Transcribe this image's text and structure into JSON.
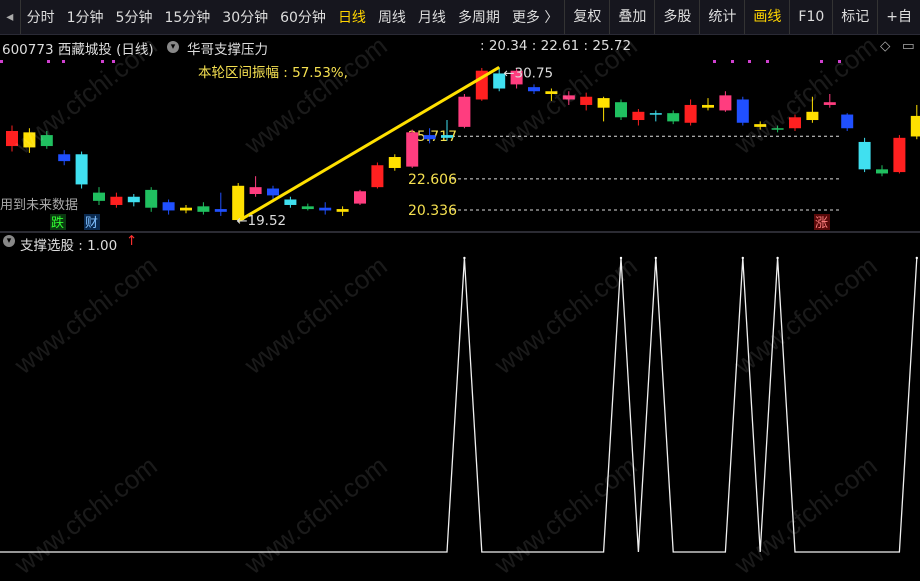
{
  "toolbar": {
    "periods": [
      "分时",
      "1分钟",
      "5分钟",
      "15分钟",
      "30分钟",
      "60分钟",
      "日线",
      "周线",
      "月线",
      "多周期",
      "更多 〉"
    ],
    "active_period": "日线",
    "tools": [
      "复权",
      "叠加",
      "多股",
      "统计",
      "画线",
      "F10",
      "标记",
      "+自"
    ],
    "highlight_tool": "画线"
  },
  "info": {
    "stock": "600773 西藏城投 (日线)",
    "indicator_name": "华哥支撑压力",
    "indicator_values": ": 20.34 : 22.61 : 25.72"
  },
  "sub_header": {
    "label": "支撑选股 : 1.00",
    "arrow": "↑"
  },
  "watermark": "www.cfchi.com",
  "chart_data": [
    {
      "type": "candlestick",
      "name": "华哥支撑压力",
      "ylim": [
        18.8,
        31.5
      ],
      "candles": [
        {
          "o": 25.0,
          "c": 26.1,
          "h": 26.5,
          "l": 24.6
        },
        {
          "o": 24.9,
          "c": 26.0,
          "h": 26.3,
          "l": 24.5
        },
        {
          "o": 25.8,
          "c": 25.0,
          "h": 26.1,
          "l": 24.8
        },
        {
          "o": 24.4,
          "c": 23.9,
          "h": 24.7,
          "l": 23.6
        },
        {
          "o": 24.4,
          "c": 22.2,
          "h": 24.6,
          "l": 21.9
        },
        {
          "o": 21.6,
          "c": 21.0,
          "h": 22.0,
          "l": 20.7
        },
        {
          "o": 20.7,
          "c": 21.3,
          "h": 21.6,
          "l": 20.5
        },
        {
          "o": 21.3,
          "c": 20.9,
          "h": 21.5,
          "l": 20.6
        },
        {
          "o": 21.8,
          "c": 20.5,
          "h": 22.0,
          "l": 20.2
        },
        {
          "o": 20.9,
          "c": 20.3,
          "h": 21.1,
          "l": 20.0
        },
        {
          "o": 20.3,
          "c": 20.5,
          "h": 20.7,
          "l": 20.1
        },
        {
          "o": 20.6,
          "c": 20.2,
          "h": 20.9,
          "l": 20.0
        },
        {
          "o": 20.4,
          "c": 20.2,
          "h": 21.6,
          "l": 19.9
        },
        {
          "o": 19.6,
          "c": 22.1,
          "h": 22.3,
          "l": 19.5
        },
        {
          "o": 21.5,
          "c": 22.0,
          "h": 22.8,
          "l": 21.3
        },
        {
          "o": 21.9,
          "c": 21.4,
          "h": 22.1,
          "l": 21.1
        },
        {
          "o": 21.1,
          "c": 20.7,
          "h": 21.3,
          "l": 20.5
        },
        {
          "o": 20.6,
          "c": 20.4,
          "h": 20.8,
          "l": 20.3
        },
        {
          "o": 20.5,
          "c": 20.3,
          "h": 20.9,
          "l": 20.0
        },
        {
          "o": 20.2,
          "c": 20.4,
          "h": 20.6,
          "l": 19.9
        },
        {
          "o": 20.8,
          "c": 21.7,
          "h": 21.8,
          "l": 20.7
        },
        {
          "o": 22.0,
          "c": 23.6,
          "h": 23.8,
          "l": 21.9
        },
        {
          "o": 23.4,
          "c": 24.2,
          "h": 24.4,
          "l": 23.2
        },
        {
          "o": 23.5,
          "c": 26.0,
          "h": 26.2,
          "l": 23.4
        },
        {
          "o": 25.8,
          "c": 25.5,
          "h": 26.3,
          "l": 25.2
        },
        {
          "o": 25.8,
          "c": 25.6,
          "h": 26.9,
          "l": 25.4
        },
        {
          "o": 26.4,
          "c": 28.6,
          "h": 28.8,
          "l": 26.3
        },
        {
          "o": 28.4,
          "c": 30.5,
          "h": 30.7,
          "l": 28.3
        },
        {
          "o": 30.3,
          "c": 29.2,
          "h": 30.75,
          "l": 29.0
        },
        {
          "o": 29.5,
          "c": 30.5,
          "h": 30.7,
          "l": 29.2
        },
        {
          "o": 29.3,
          "c": 29.0,
          "h": 29.5,
          "l": 28.8
        },
        {
          "o": 28.8,
          "c": 29.0,
          "h": 29.2,
          "l": 28.3
        },
        {
          "o": 28.4,
          "c": 28.7,
          "h": 29.0,
          "l": 28.0
        },
        {
          "o": 28.0,
          "c": 28.6,
          "h": 28.9,
          "l": 27.6
        },
        {
          "o": 27.8,
          "c": 28.5,
          "h": 28.6,
          "l": 26.8
        },
        {
          "o": 28.2,
          "c": 27.1,
          "h": 28.4,
          "l": 26.9
        },
        {
          "o": 26.9,
          "c": 27.5,
          "h": 27.7,
          "l": 26.5
        },
        {
          "o": 27.4,
          "c": 27.3,
          "h": 27.6,
          "l": 26.8
        },
        {
          "o": 27.4,
          "c": 26.8,
          "h": 27.6,
          "l": 26.6
        },
        {
          "o": 26.7,
          "c": 28.0,
          "h": 28.4,
          "l": 26.5
        },
        {
          "o": 27.8,
          "c": 28.0,
          "h": 28.5,
          "l": 27.6
        },
        {
          "o": 27.6,
          "c": 28.7,
          "h": 29.0,
          "l": 27.5
        },
        {
          "o": 28.4,
          "c": 26.7,
          "h": 28.6,
          "l": 26.5
        },
        {
          "o": 26.4,
          "c": 26.6,
          "h": 26.8,
          "l": 26.2
        },
        {
          "o": 26.3,
          "c": 26.2,
          "h": 26.5,
          "l": 26.0
        },
        {
          "o": 26.3,
          "c": 27.1,
          "h": 27.3,
          "l": 26.1
        },
        {
          "o": 26.9,
          "c": 27.5,
          "h": 28.6,
          "l": 26.7
        },
        {
          "o": 28.0,
          "c": 28.2,
          "h": 28.8,
          "l": 27.8
        },
        {
          "o": 27.3,
          "c": 26.3,
          "h": 27.4,
          "l": 26.1
        },
        {
          "o": 25.3,
          "c": 23.3,
          "h": 25.6,
          "l": 23.1
        },
        {
          "o": 23.3,
          "c": 23.0,
          "h": 23.6,
          "l": 22.8
        },
        {
          "o": 23.1,
          "c": 25.6,
          "h": 25.8,
          "l": 23.0
        },
        {
          "o": 25.7,
          "c": 27.2,
          "h": 28.0,
          "l": 25.5
        }
      ],
      "levels": [
        25.717,
        22.606,
        20.336
      ],
      "annotations": {
        "amplitude": "本轮区间振幅 : 57.53%,",
        "high_label": "30.75",
        "low_label": "19.52",
        "fall_badge": "跌",
        "finance_badge": "财",
        "rise_badge": "涨",
        "future_data_note": "用到未来数据"
      }
    },
    {
      "type": "line",
      "name": "支撑选股",
      "ylim": [
        0,
        1
      ],
      "values": [
        0,
        0,
        0,
        0,
        0,
        0,
        0,
        0,
        0,
        0,
        0,
        0,
        0,
        0,
        0,
        0,
        0,
        0,
        0,
        0,
        0,
        0,
        0,
        0,
        0,
        0,
        1,
        0,
        0,
        0,
        0,
        0,
        0,
        0,
        0,
        1,
        0,
        1,
        0,
        0,
        0,
        0,
        1,
        0,
        1,
        0,
        0,
        0,
        0,
        0,
        0,
        0,
        1
      ]
    }
  ]
}
